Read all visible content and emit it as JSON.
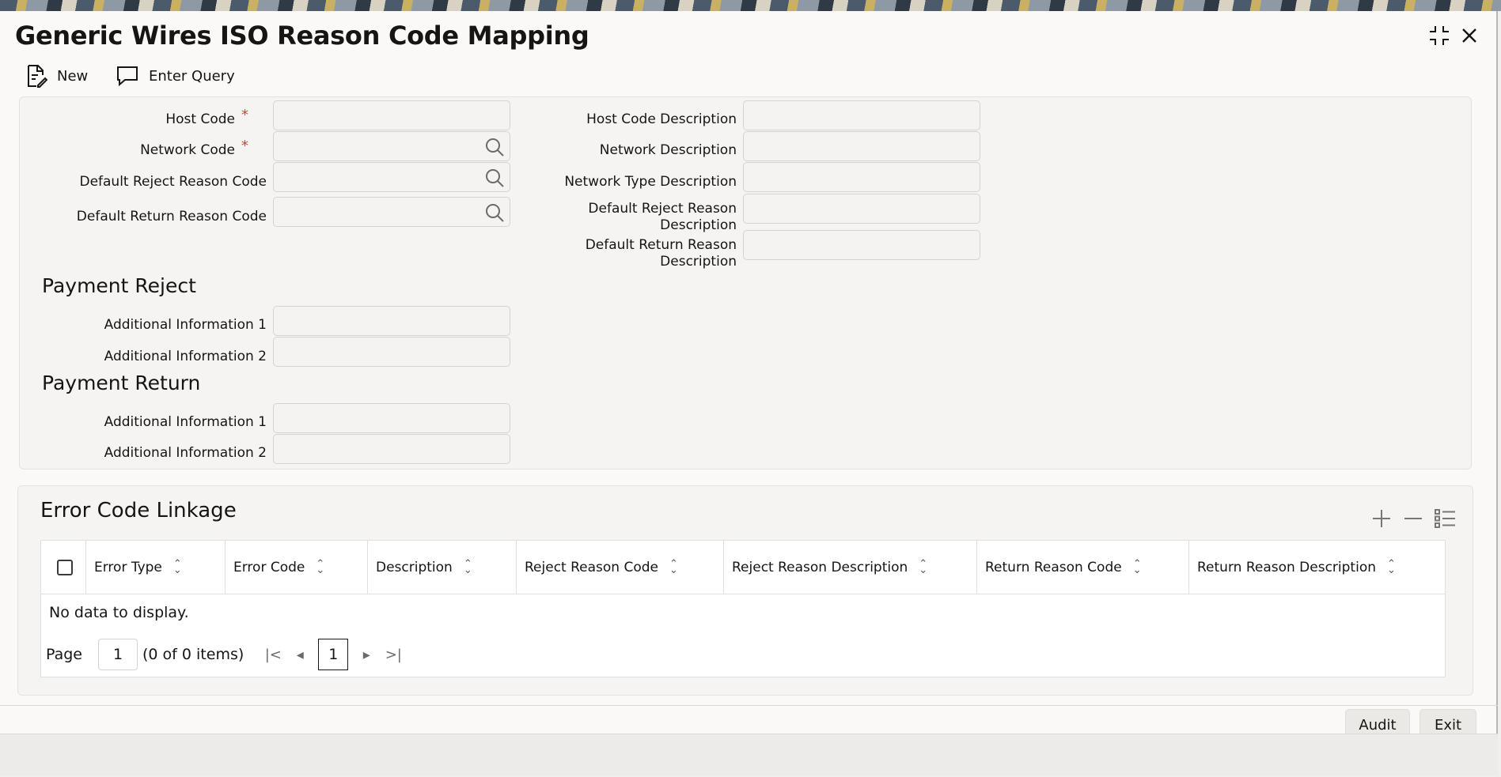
{
  "window": {
    "title": "Generic Wires ISO Reason Code Mapping"
  },
  "toolbar": {
    "new_label": "New",
    "enter_query_label": "Enter Query"
  },
  "form": {
    "host_code": {
      "label": "Host Code",
      "value": ""
    },
    "network_code": {
      "label": "Network Code",
      "value": ""
    },
    "default_reject_reason_code": {
      "label": "Default Reject Reason Code",
      "value": ""
    },
    "default_return_reason_code": {
      "label": "Default Return Reason Code",
      "value": ""
    },
    "host_code_description": {
      "label": "Host Code Description",
      "value": ""
    },
    "network_description": {
      "label": "Network Description",
      "value": ""
    },
    "network_type_description": {
      "label": "Network Type Description",
      "value": ""
    },
    "default_reject_reason_description": {
      "label_line1": "Default Reject Reason",
      "label_line2": "Description",
      "value": ""
    },
    "default_return_reason_description": {
      "label_line1": "Default Return Reason",
      "label_line2": "Description",
      "value": ""
    },
    "required_marker": "*"
  },
  "payment_reject": {
    "title": "Payment Reject",
    "additional_info_1": {
      "label": "Additional Information 1",
      "value": ""
    },
    "additional_info_2": {
      "label": "Additional Information 2",
      "value": ""
    }
  },
  "payment_return": {
    "title": "Payment Return",
    "additional_info_1": {
      "label": "Additional Information 1",
      "value": ""
    },
    "additional_info_2": {
      "label": "Additional Information 2",
      "value": ""
    }
  },
  "error_code_linkage": {
    "title": "Error Code Linkage",
    "columns": [
      "Error Type",
      "Error Code",
      "Description",
      "Reject Reason Code",
      "Reject Reason Description",
      "Return Reason Code",
      "Return Reason Description"
    ],
    "rows": [],
    "empty_text": "No data to display.",
    "pager": {
      "page_label": "Page",
      "page_value": "1",
      "items_text": "(0 of 0 items)",
      "current_page": "1"
    }
  },
  "footer": {
    "audit_label": "Audit",
    "exit_label": "Exit"
  }
}
